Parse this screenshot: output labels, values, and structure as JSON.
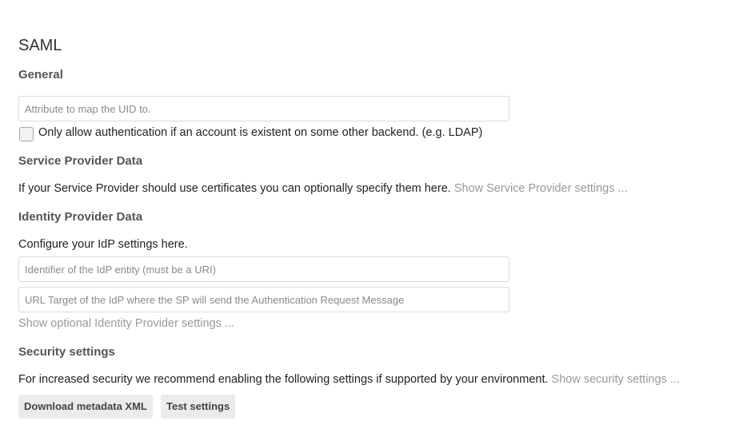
{
  "section": {
    "title": "SAML"
  },
  "general": {
    "heading": "General",
    "uid_input": {
      "value": "",
      "placeholder": "Attribute to map the UID to."
    },
    "existing_account_checkbox": {
      "checked": false,
      "label": "Only allow authentication if an account is existent on some other backend. (e.g. LDAP)"
    }
  },
  "service_provider": {
    "heading": "Service Provider Data",
    "description": "If your Service Provider should use certificates you can optionally specify them here.",
    "show_link": "Show Service Provider settings ..."
  },
  "identity_provider": {
    "heading": "Identity Provider Data",
    "description": "Configure your IdP settings here.",
    "entity_input": {
      "value": "",
      "placeholder": "Identifier of the IdP entity (must be a URI)"
    },
    "sso_url_input": {
      "value": "",
      "placeholder": "URL Target of the IdP where the SP will send the Authentication Request Message"
    },
    "show_link": "Show optional Identity Provider settings ..."
  },
  "security": {
    "heading": "Security settings",
    "description": "For increased security we recommend enabling the following settings if supported by your environment.",
    "show_link": "Show security settings ..."
  },
  "actions": {
    "download_label": "Download metadata XML",
    "test_label": "Test settings"
  }
}
